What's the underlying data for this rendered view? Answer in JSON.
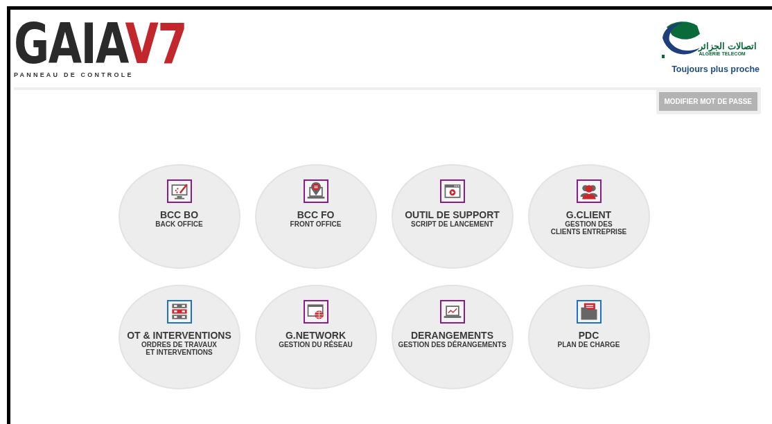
{
  "logo": {
    "name": "GAIA",
    "version": "V7",
    "subtitle": "PANNEAU DE CONTROLE"
  },
  "partner_logo": {
    "arabic": "اتصالات الجزائر",
    "latin": "ALGERIE TELECOM",
    "slogan": "Toujours plus proche"
  },
  "password_button": "MODIFIER MOT DE PASSE",
  "modules": [
    {
      "title": "BCC BO",
      "subtitle": [
        "BACK OFFICE"
      ],
      "kind": "monitor-pen",
      "color": "#8b1a8b"
    },
    {
      "title": "BCC FO",
      "subtitle": [
        "FRONT OFFICE"
      ],
      "kind": "laptop-pin",
      "color": "#8b1a8b"
    },
    {
      "title": "OUTIL DE SUPPORT",
      "subtitle": [
        "SCRIPT DE LANCEMENT"
      ],
      "kind": "window-play",
      "color": "#8b1a8b"
    },
    {
      "title": "G.CLIENT",
      "subtitle": [
        "GESTION DES",
        "CLIENTS ENTREPRISE"
      ],
      "kind": "users",
      "color": "#8b1a8b"
    },
    {
      "title": "OT & INTERVENTIONS",
      "subtitle": [
        "ORDRES DE TRAVAUX",
        "ET INTERVENTIONS"
      ],
      "kind": "server",
      "color": "#1f6fd1"
    },
    {
      "title": "G.NETWORK",
      "subtitle": [
        "GESTION DU RÉSEAU"
      ],
      "kind": "window-globe",
      "color": "#8b1a8b"
    },
    {
      "title": "DERANGEMENTS",
      "subtitle": [
        "GESTION DES DÉRANGEMENTS"
      ],
      "kind": "laptop-chart",
      "color": "#8b1a8b"
    },
    {
      "title": "PDC",
      "subtitle": [
        "PLAN DE CHARGE"
      ],
      "kind": "folder",
      "color": "#1f6fd1"
    }
  ]
}
